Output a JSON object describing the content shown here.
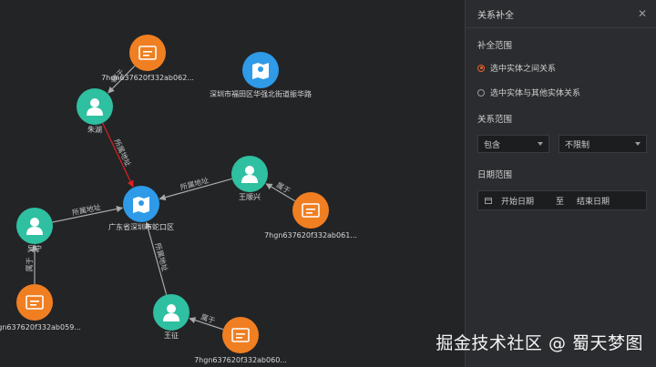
{
  "graph": {
    "nodes": [
      {
        "id": "n_zhuhu",
        "label": "朱湖",
        "type": "person"
      },
      {
        "id": "n_hash062",
        "label": "7hgn637620f332ab062...",
        "type": "company"
      },
      {
        "id": "n_shenzhen",
        "label": "深圳市福田区华强北街道振华路",
        "type": "address"
      },
      {
        "id": "n_guangdong",
        "label": "广东省深圳市蛇口区",
        "type": "address"
      },
      {
        "id": "n_wangshunxing",
        "label": "王顺兴",
        "type": "person"
      },
      {
        "id": "n_hash061",
        "label": "7hgn637620f332ab061...",
        "type": "company"
      },
      {
        "id": "n_lixiao",
        "label": "吴宁",
        "type": "person"
      },
      {
        "id": "n_hash059",
        "label": "7hgn637620f332ab059...",
        "type": "company"
      },
      {
        "id": "n_wangzheng",
        "label": "王征",
        "type": "person"
      },
      {
        "id": "n_hash060",
        "label": "7hgn637620f332ab060...",
        "type": "company"
      }
    ],
    "edges": [
      {
        "from": "n_hash062",
        "to": "n_zhuhu",
        "label": "属于",
        "highlight": false
      },
      {
        "from": "n_zhuhu",
        "to": "n_guangdong",
        "label": "所属地址",
        "highlight": true
      },
      {
        "from": "n_wangshunxing",
        "to": "n_guangdong",
        "label": "所属地址",
        "highlight": false
      },
      {
        "from": "n_hash061",
        "to": "n_wangshunxing",
        "label": "属于",
        "highlight": false
      },
      {
        "from": "n_lixiao",
        "to": "n_guangdong",
        "label": "所属地址",
        "highlight": false
      },
      {
        "from": "n_hash059",
        "to": "n_lixiao",
        "label": "属于",
        "highlight": false
      },
      {
        "from": "n_wangzheng",
        "to": "n_guangdong",
        "label": "所属地址",
        "highlight": false
      },
      {
        "from": "n_hash060",
        "to": "n_wangzheng",
        "label": "属于",
        "highlight": false
      }
    ]
  },
  "colors": {
    "person": "#2ec0a0",
    "company": "#f07f22",
    "address": "#2e9ae8",
    "edge": "#a9a9a9",
    "edge_highlight": "#e02020",
    "accent": "#e8632b"
  },
  "icons": {
    "person": "person-icon",
    "company": "company-card-icon",
    "address": "map-location-icon"
  },
  "panel": {
    "title": "关系补全",
    "close": "✕",
    "scope": {
      "title": "补全范围",
      "options": [
        {
          "label": "选中实体之间关系",
          "checked": true
        },
        {
          "label": "选中实体与其他实体关系",
          "checked": false
        }
      ]
    },
    "relation": {
      "title": "关系范围",
      "select1": "包含",
      "select2": "不限制"
    },
    "date": {
      "title": "日期范围",
      "start_placeholder": "开始日期",
      "separator": "至",
      "end_placeholder": "结束日期"
    }
  },
  "watermark": "掘金技术社区 @ 蜀天梦图"
}
